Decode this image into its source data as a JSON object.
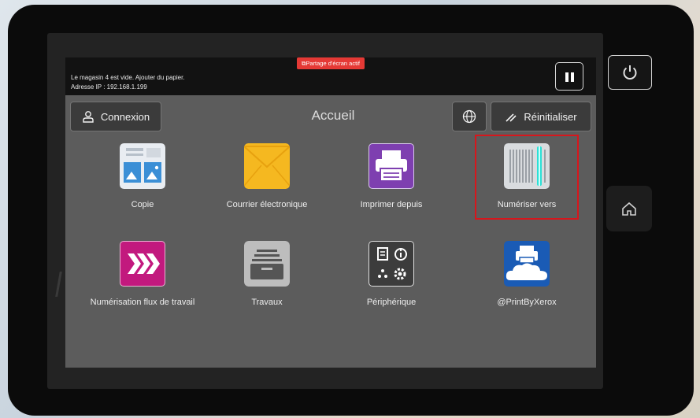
{
  "status": {
    "line1": "Le magasin 4 est vide.  Ajouter du papier.",
    "line2": "Adresse IP : 192.168.1.199",
    "share_badge": "Partage d'écran actif"
  },
  "toolbar": {
    "login_label": "Connexion",
    "title": "Accueil",
    "reset_label": "Réinitialiser"
  },
  "apps": [
    {
      "label": "Copie",
      "icon": "copy-icon"
    },
    {
      "label": "Courrier électronique",
      "icon": "envelope-icon"
    },
    {
      "label": "Imprimer depuis",
      "icon": "printer-icon"
    },
    {
      "label": "Numériser vers",
      "icon": "scanner-icon",
      "highlighted": true
    },
    {
      "label": "Numérisation flux de travail",
      "icon": "workflow-chevrons-icon"
    },
    {
      "label": "Travaux",
      "icon": "jobs-tray-icon"
    },
    {
      "label": "Périphérique",
      "icon": "device-settings-icon"
    },
    {
      "label": "@PrintByXerox",
      "icon": "cloud-print-icon"
    }
  ],
  "colors": {
    "highlight": "#d7161c",
    "copy_tile": "#3b8fd6",
    "email_tile": "#f5b820",
    "print_tile": "#7e3fb0",
    "workflow_tile": "#c2197e",
    "cloud_tile": "#1a5bb5"
  }
}
